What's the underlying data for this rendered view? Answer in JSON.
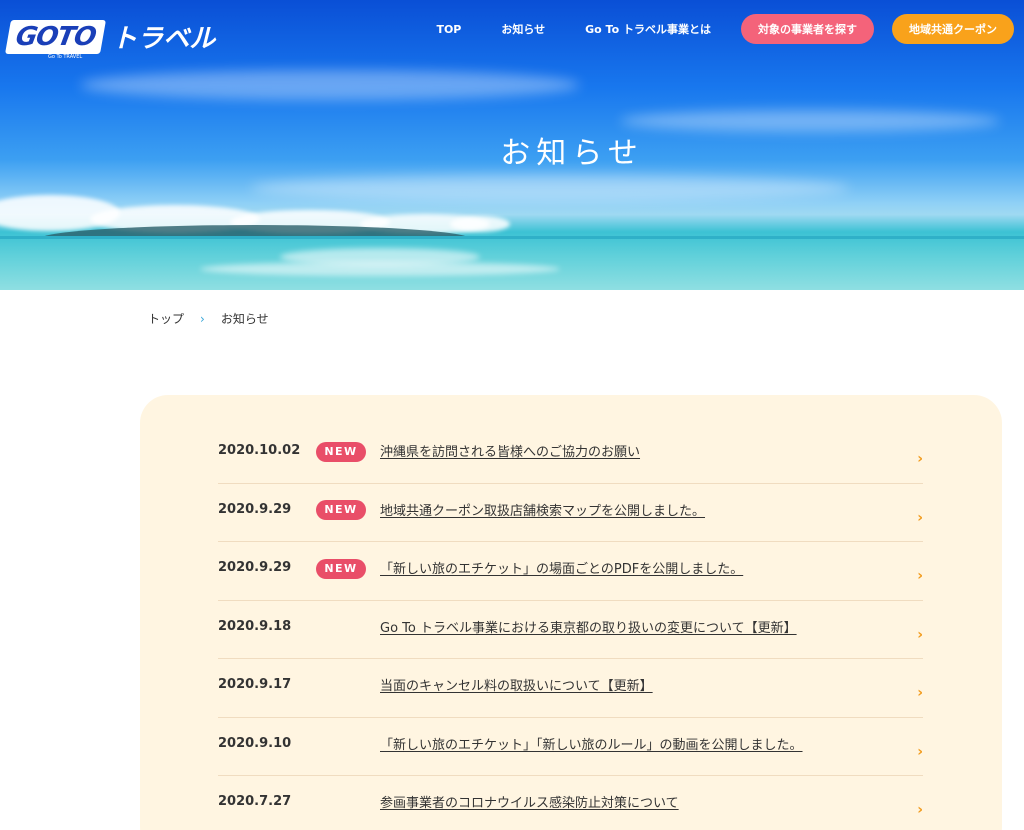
{
  "header": {
    "logo_badge": "GOTO",
    "logo_sub": "Go To TRAVEL",
    "logo_text": "トラベル",
    "nav": {
      "top": "TOP",
      "news": "お知らせ",
      "about": "Go To トラベル事業とは",
      "find_button": "対象の事業者を探す",
      "coupon_button": "地域共通クーポン"
    },
    "colors": {
      "find_button": "#f4637a",
      "coupon_button": "#f9a21b"
    }
  },
  "hero": {
    "title": "お知らせ"
  },
  "breadcrumb": {
    "home": "トップ",
    "separator": "›",
    "current": "お知らせ"
  },
  "news": {
    "badge_label": "NEW",
    "items": [
      {
        "date": "2020.10.02",
        "is_new": true,
        "title": "沖縄県を訪問される皆様へのご協力のお願い"
      },
      {
        "date": "2020.9.29",
        "is_new": true,
        "title": "地域共通クーポン取扱店舗検索マップを公開しました。"
      },
      {
        "date": "2020.9.29",
        "is_new": true,
        "title": "「新しい旅のエチケット」の場面ごとのPDFを公開しました。"
      },
      {
        "date": "2020.9.18",
        "is_new": false,
        "title": "Go To トラベル事業における東京都の取り扱いの変更について【更新】"
      },
      {
        "date": "2020.9.17",
        "is_new": false,
        "title": "当面のキャンセル料の取扱いについて【更新】"
      },
      {
        "date": "2020.9.10",
        "is_new": false,
        "title": "「新しい旅のエチケット」「新しい旅のルール」の動画を公開しました。"
      },
      {
        "date": "2020.7.27",
        "is_new": false,
        "title": "参画事業者のコロナウイルス感染防止対策について"
      }
    ]
  }
}
